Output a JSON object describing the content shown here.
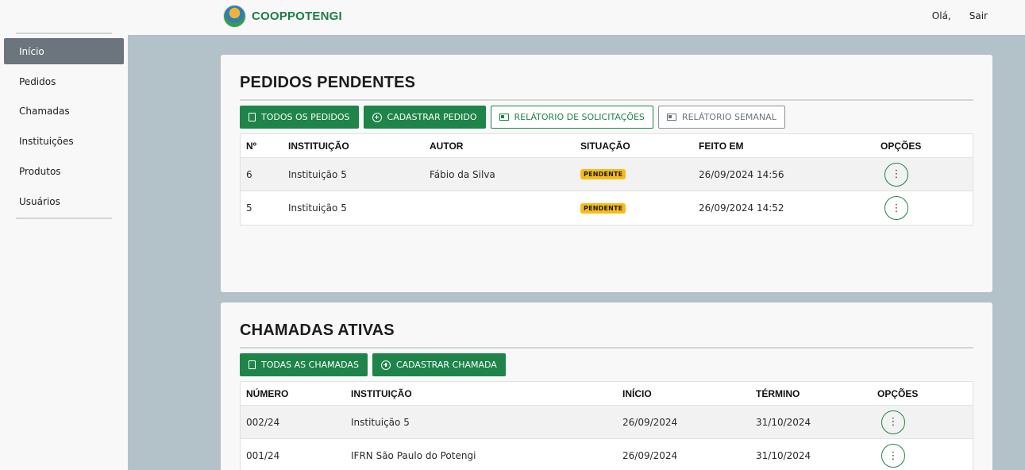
{
  "header": {
    "brand": "COOPPOTENGI",
    "greeting": "Olá,",
    "logout": "Sair"
  },
  "sidebar": {
    "items": [
      {
        "label": "Início",
        "active": true
      },
      {
        "label": "Pedidos"
      },
      {
        "label": "Chamadas"
      },
      {
        "label": "Instituições"
      },
      {
        "label": "Produtos"
      },
      {
        "label": "Usuários"
      }
    ]
  },
  "pedidos": {
    "title": "PEDIDOS PENDENTES",
    "buttons": {
      "todos": "TODOS OS PEDIDOS",
      "cadastrar": "CADASTRAR PEDIDO",
      "relatorio_solicitacoes": "RELÁTORIO DE SOLICITAÇÕES",
      "relatorio_semanal": "RELÁTORIO SEMANAL"
    },
    "columns": [
      "Nº",
      "INSTITUIÇÃO",
      "AUTOR",
      "SITUAÇÃO",
      "FEITO EM",
      "OPÇÕES"
    ],
    "rows": [
      {
        "num": "6",
        "instituicao": "Instituição 5",
        "autor": "Fábio da Silva",
        "situacao": "PENDENTE",
        "feito_em": "26/09/2024 14:56",
        "opcoes": "⋮"
      },
      {
        "num": "5",
        "instituicao": "Instituição 5",
        "autor": "",
        "situacao": "PENDENTE",
        "feito_em": "26/09/2024 14:52",
        "opcoes": "⋮"
      }
    ]
  },
  "chamadas": {
    "title": "CHAMADAS ATIVAS",
    "buttons": {
      "todas": "TODAS AS CHAMADAS",
      "cadastrar": "CADASTRAR CHAMADA"
    },
    "columns": [
      "NÚMERO",
      "INSTITUIÇÃO",
      "INÍCIO",
      "TÉRMINO",
      "OPÇÕES"
    ],
    "rows": [
      {
        "numero": "002/24",
        "instituicao": "Instituição 5",
        "inicio": "26/09/2024",
        "termino": "31/10/2024",
        "opcoes": "⋮"
      },
      {
        "numero": "001/24",
        "instituicao": "IFRN São Paulo do Potengi",
        "inicio": "26/09/2024",
        "termino": "31/10/2024",
        "opcoes": "⋮"
      }
    ]
  },
  "colors": {
    "accent": "#1e8449",
    "badge": "#f6bd16",
    "sidebar_active": "#6c757d",
    "page_bg": "#b3c1c8"
  }
}
